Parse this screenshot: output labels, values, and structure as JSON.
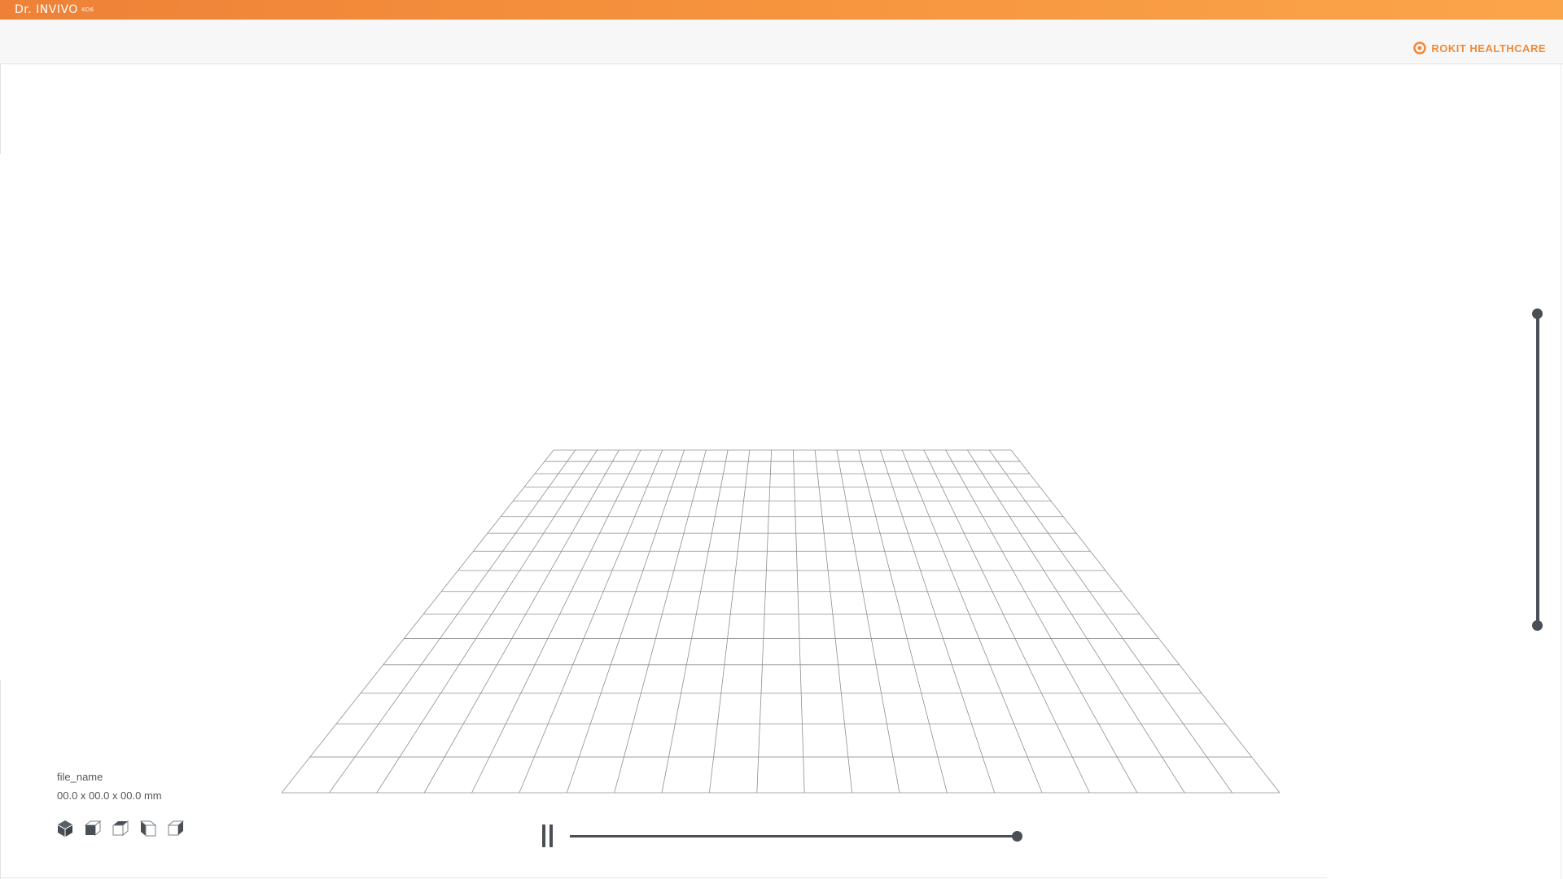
{
  "app": {
    "title": "Dr. INVIVO",
    "version": "4D6"
  },
  "header": {
    "brand": "ROKIT HEALTHCARE"
  },
  "model": {
    "file_name": "file_name",
    "dimensions": "00.0 x 00.0 x 00.0 mm"
  },
  "view_buttons": [
    {
      "name": "view-iso-icon"
    },
    {
      "name": "view-front-icon"
    },
    {
      "name": "view-top-icon"
    },
    {
      "name": "view-left-icon"
    },
    {
      "name": "view-right-icon"
    }
  ],
  "playback": {
    "state": "playing",
    "progress": 1.0
  },
  "layer_slider": {
    "top_value": 1.0,
    "bottom_value": 0.0
  },
  "colors": {
    "accent": "#f08a3a",
    "control": "#4a4f55",
    "grid": "#8f8f8f"
  }
}
